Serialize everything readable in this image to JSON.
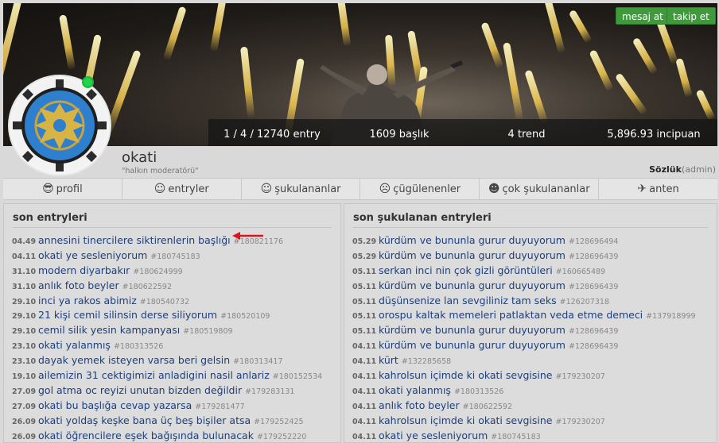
{
  "header": {
    "buttons": {
      "message": "mesaj at",
      "follow": "takip et"
    },
    "stats": {
      "entries": "1 / 4 / 12740 entry",
      "topics": "1609 başlık",
      "trends": "4 trend",
      "points": "5,896.93 incipuan"
    }
  },
  "profile": {
    "username": "okati",
    "tagline": "\"halkın moderatörü\"",
    "role_main": "Sözlük",
    "role_sub": "(admin)",
    "online": true
  },
  "tabs": [
    {
      "icon": "face-glasses-icon",
      "glyph": "😎",
      "label": "profil"
    },
    {
      "icon": "smile-icon",
      "glyph": "☺",
      "label": "entryler"
    },
    {
      "icon": "smile-icon",
      "glyph": "☺",
      "label": "şukulananlar"
    },
    {
      "icon": "frown-icon",
      "glyph": "☹",
      "label": "çügülenenler"
    },
    {
      "icon": "grin-icon",
      "glyph": "☻",
      "label": "çok şukulananlar"
    },
    {
      "icon": "satellite-icon",
      "glyph": "✈",
      "label": "anten"
    }
  ],
  "left_panel": {
    "title": "son entryleri",
    "entries": [
      {
        "date": "04.49",
        "title": "annesini tinercilere siktirenlerin başlığı",
        "id": "#180821176"
      },
      {
        "date": "04.11",
        "title": "okati ye sesleniyorum",
        "id": "#180745183"
      },
      {
        "date": "31.10",
        "title": "modern diyarbakır",
        "id": "#180624999"
      },
      {
        "date": "31.10",
        "title": "anlık foto beyler",
        "id": "#180622592"
      },
      {
        "date": "29.10",
        "title": "inci ya rakos abimiz",
        "id": "#180540732"
      },
      {
        "date": "29.10",
        "title": "21 kişi cemil silinsin derse siliyorum",
        "id": "#180520109"
      },
      {
        "date": "29.10",
        "title": "cemil silik yesin kampanyası",
        "id": "#180519809"
      },
      {
        "date": "23.10",
        "title": "okati yalanmış",
        "id": "#180313526"
      },
      {
        "date": "23.10",
        "title": "dayak yemek isteyen varsa beri gelsin",
        "id": "#180313417"
      },
      {
        "date": "19.10",
        "title": "ailemizin 31 cektigimizi anladigini nasil anlariz",
        "id": "#180152534"
      },
      {
        "date": "27.09",
        "title": "gol atma oc reyizi unutan bizden değildir",
        "id": "#179283131"
      },
      {
        "date": "27.09",
        "title": "okati bu başlığa cevap yazarsa",
        "id": "#179281477"
      },
      {
        "date": "26.09",
        "title": "okati yoldaş keşke bana üç beş bişiler atsa",
        "id": "#179252425"
      },
      {
        "date": "26.09",
        "title": "okati öğrencilere eşek bağışında bulunacak",
        "id": "#179252220"
      }
    ]
  },
  "right_panel": {
    "title": "son şukulanan entryleri",
    "entries": [
      {
        "date": "05.29",
        "title": "kürdüm ve bununla gurur duyuyorum",
        "id": "#128696494"
      },
      {
        "date": "05.29",
        "title": "kürdüm ve bununla gurur duyuyorum",
        "id": "#128696439"
      },
      {
        "date": "05.11",
        "title": "serkan inci nin çok gizli görüntüleri",
        "id": "#160665489"
      },
      {
        "date": "05.11",
        "title": "kürdüm ve bununla gurur duyuyorum",
        "id": "#128696439"
      },
      {
        "date": "05.11",
        "title": "düşünsenize lan sevgiliniz tam seks",
        "id": "#126207318"
      },
      {
        "date": "05.11",
        "title": "orospu kaltak memeleri patlaktan veda etme demeci",
        "id": "#137918999"
      },
      {
        "date": "05.11",
        "title": "kürdüm ve bununla gurur duyuyorum",
        "id": "#128696439"
      },
      {
        "date": "04.11",
        "title": "kürdüm ve bununla gurur duyuyorum",
        "id": "#128696439"
      },
      {
        "date": "04.11",
        "title": "kürt",
        "id": "#132285658"
      },
      {
        "date": "04.11",
        "title": "kahrolsun içimde ki okati sevgisine",
        "id": "#179230207"
      },
      {
        "date": "04.11",
        "title": "okati yalanmış",
        "id": "#180313526"
      },
      {
        "date": "04.11",
        "title": "anlık foto beyler",
        "id": "#180622592"
      },
      {
        "date": "04.11",
        "title": "kahrolsun içimde ki okati sevgisine",
        "id": "#179230207"
      },
      {
        "date": "04.11",
        "title": "okati ye sesleniyorum",
        "id": "#180745183"
      }
    ]
  },
  "colors": {
    "link": "#1d3f7a",
    "button_green": "#3e9a3a",
    "online": "#22d44a",
    "arrow": "#e0121b"
  }
}
